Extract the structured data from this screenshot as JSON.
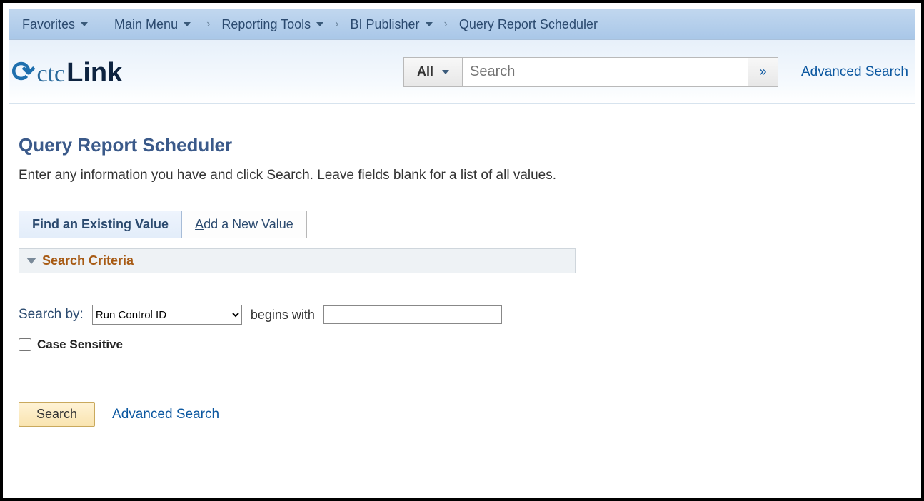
{
  "topbar": {
    "favorites": "Favorites",
    "main_menu": "Main Menu",
    "crumbs": [
      {
        "label": "Reporting Tools",
        "has_menu": true
      },
      {
        "label": "BI Publisher",
        "has_menu": true
      },
      {
        "label": "Query Report Scheduler",
        "has_menu": false
      }
    ]
  },
  "header": {
    "logo_ctc": "ctc",
    "logo_link": "Link",
    "search_scope": "All",
    "search_placeholder": "Search",
    "go_glyph": "»",
    "advanced_search": "Advanced Search"
  },
  "page": {
    "title": "Query Report Scheduler",
    "instructions": "Enter any information you have and click Search. Leave fields blank for a list of all values."
  },
  "tabs": {
    "find": "Find an Existing Value",
    "add_prefix": "A",
    "add_rest": "dd a New Value"
  },
  "criteria": {
    "header": "Search Criteria",
    "search_by_label": "Search by:",
    "search_by_option": "Run Control ID",
    "begins_with": "begins with",
    "search_value": "",
    "case_sensitive": "Case Sensitive"
  },
  "actions": {
    "search": "Search",
    "advanced": "Advanced Search"
  }
}
